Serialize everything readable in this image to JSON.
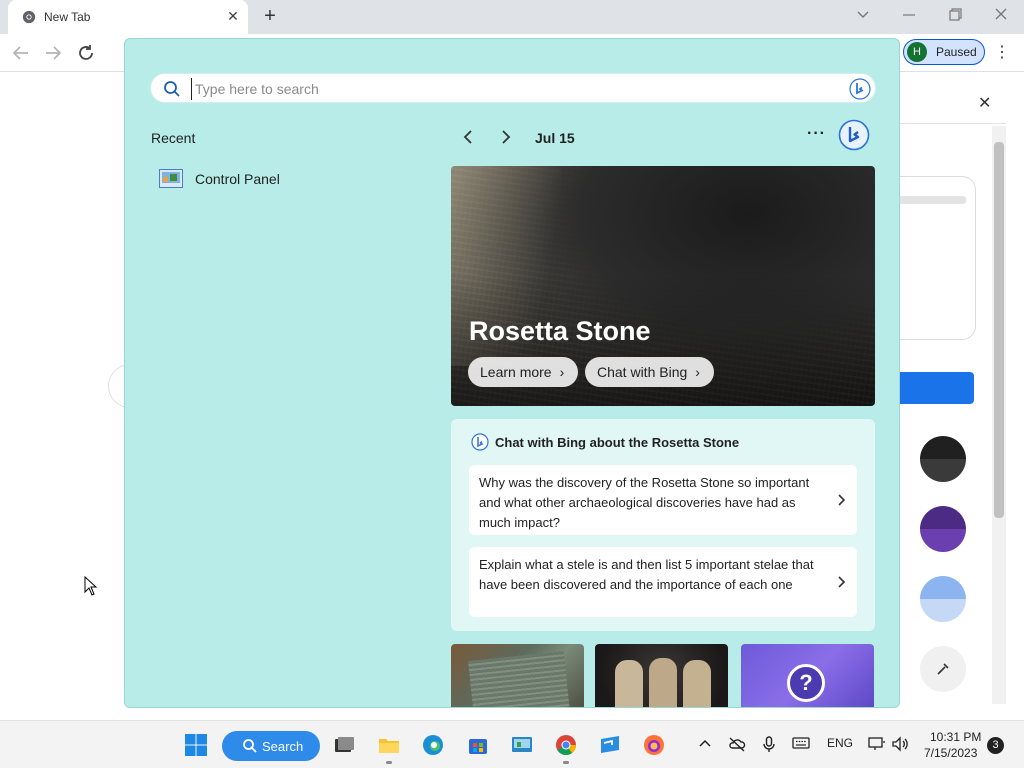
{
  "browser": {
    "tab_title": "New Tab",
    "tab_close_glyph": "✕",
    "new_tab_glyph": "+",
    "profile_initial": "H",
    "profile_status": "Paused",
    "menu_glyph": "⋮",
    "side_panel_close_glyph": "✕"
  },
  "flyout": {
    "search_placeholder": "Type here to search",
    "recent_title": "Recent",
    "recent_items": [
      {
        "label": "Control Panel",
        "icon": "control-panel-icon"
      }
    ],
    "date": "Jul 15",
    "more_glyph": "···",
    "hero": {
      "title": "Rosetta Stone",
      "learn_more": "Learn more",
      "chat_with_bing": "Chat with Bing"
    },
    "chat_card": {
      "heading": "Chat with Bing about the Rosetta Stone",
      "prompts": [
        "Why was the discovery of the Rosetta Stone so important and what other archaeological discoveries have had as much impact?",
        "Explain what a stele is and then list 5 important stelae that have been discovered and the importance of each one"
      ]
    }
  },
  "taskbar": {
    "search_label": "Search",
    "language": "ENG",
    "time": "10:31 PM",
    "date": "7/15/2023",
    "notifications": "3"
  },
  "colors": {
    "flyout_bg": "#b7ece9",
    "accent_blue": "#2e8bea",
    "chrome_blue": "#1a73e8"
  }
}
